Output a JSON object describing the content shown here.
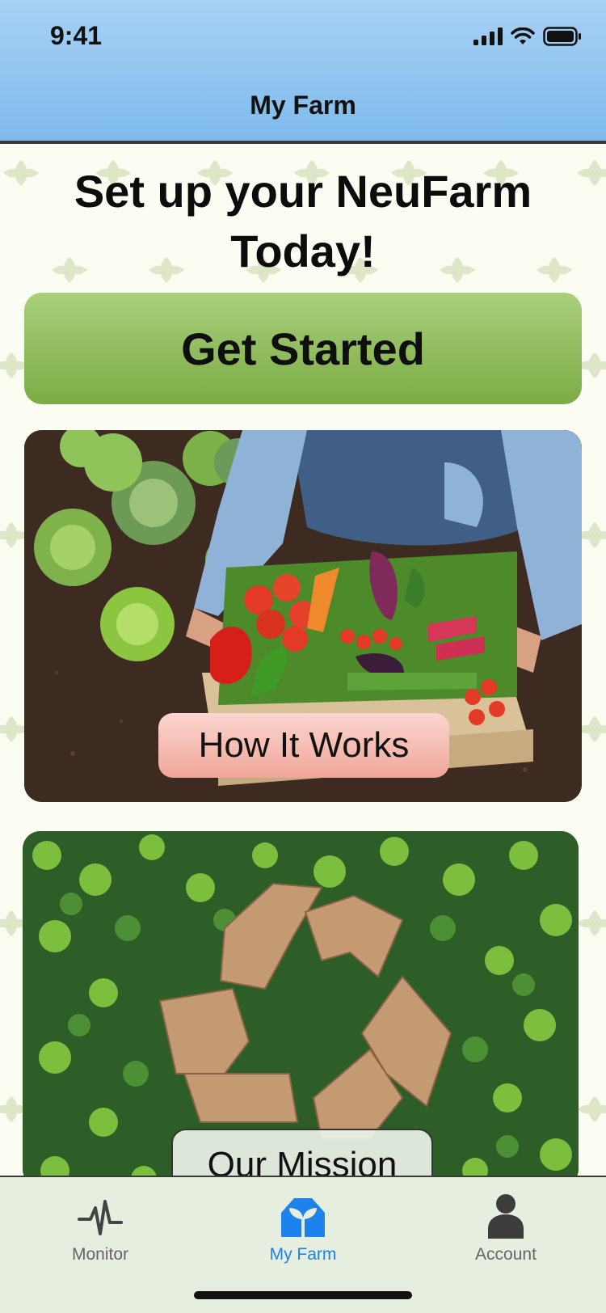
{
  "status_bar": {
    "time": "9:41"
  },
  "nav": {
    "title": "My Farm"
  },
  "main": {
    "headline_line1": "Set up your NeuFarm",
    "headline_line2": "Today!",
    "get_started_label": "Get Started",
    "how_it_works_label": "How It Works",
    "our_mission_label": "Our Mission"
  },
  "tabbar": {
    "items": [
      {
        "label": "Monitor",
        "icon": "heartbeat-icon",
        "active": false
      },
      {
        "label": "My Farm",
        "icon": "farm-sprout-icon",
        "active": true
      },
      {
        "label": "Account",
        "icon": "person-icon",
        "active": false
      }
    ]
  },
  "colors": {
    "header_gradient_top": "#a8d1f4",
    "header_gradient_bottom": "#7ebaec",
    "get_started_green": "#8dbb58",
    "how_btn_pink": "#f4b4a9",
    "active_tab_blue": "#1d82ec",
    "inactive_tab_gray": "#666666",
    "background": "#fbfdf2"
  }
}
